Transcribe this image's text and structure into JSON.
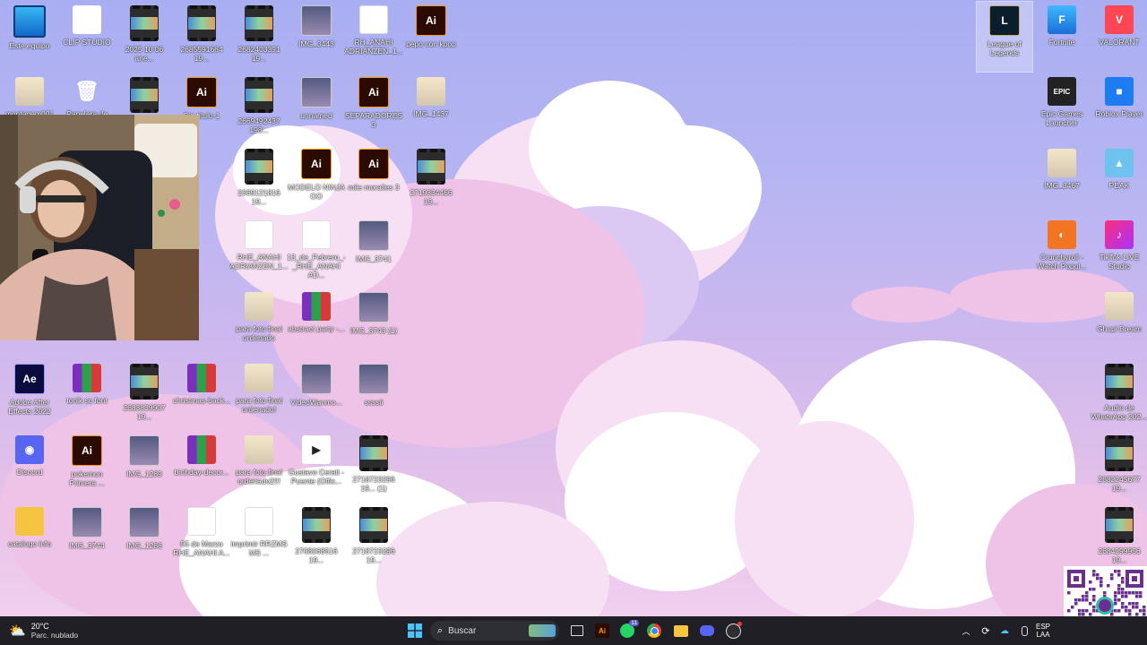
{
  "desktop_icons_left": [
    {
      "id": "pc",
      "label": "Este equipo",
      "icon": "computer-icon",
      "kind": "pc"
    },
    {
      "id": "clip",
      "label": "CLIP STUDIO",
      "icon": "clip-studio-icon",
      "kind": "clip"
    },
    {
      "id": "v1",
      "label": "2025 10 06 ane...",
      "icon": "video-icon",
      "kind": "video"
    },
    {
      "id": "v2",
      "label": "2685591664 19...",
      "icon": "video-icon",
      "kind": "video"
    },
    {
      "id": "v3",
      "label": "2682403391 19...",
      "icon": "video-icon",
      "kind": "video"
    },
    {
      "id": "img3443",
      "label": "IMG_3443",
      "icon": "image-icon",
      "kind": "img"
    },
    {
      "id": "pdf1",
      "label": "RH_ANAHI ADRIANZEN_1...",
      "icon": "pdf-icon",
      "kind": "pdf"
    },
    {
      "id": "ai1",
      "label": "pepo con kpop",
      "icon": "illustrator-icon",
      "kind": "ai"
    },
    {
      "id": "montagem",
      "label": "montagem001",
      "icon": "image-icon",
      "kind": "photo"
    },
    {
      "id": "bin",
      "label": "Papelera de",
      "icon": "recycle-bin-icon",
      "kind": "bin"
    },
    {
      "id": "v4",
      "label": "25 (1)",
      "icon": "video-icon",
      "kind": "video"
    },
    {
      "id": "ai2",
      "label": "Sin título-1",
      "icon": "illustrator-icon",
      "kind": "ai"
    },
    {
      "id": "v5",
      "label": "2669492437 198...",
      "icon": "video-icon",
      "kind": "video"
    },
    {
      "id": "unnamed",
      "label": "unnamed",
      "icon": "image-icon",
      "kind": "img"
    },
    {
      "id": "ai3",
      "label": "SEPARADORES 3",
      "icon": "illustrator-icon",
      "kind": "ai"
    },
    {
      "id": "img1437",
      "label": "IMG_1437",
      "icon": "image-icon",
      "kind": "photo"
    },
    {
      "id": "v6",
      "label": "2669121816 19...",
      "icon": "video-icon",
      "kind": "video"
    },
    {
      "id": "ai4",
      "label": "MODELO NINJA OO",
      "icon": "illustrator-icon",
      "kind": "ai"
    },
    {
      "id": "ai5",
      "label": "mile moralles 3",
      "icon": "illustrator-icon",
      "kind": "ai"
    },
    {
      "id": "v7",
      "label": "2719334466 19...",
      "icon": "video-icon",
      "kind": "video"
    },
    {
      "id": "pdf2",
      "label": "RHE_ANAHI ADRIANZEN_1...",
      "icon": "pdf-icon",
      "kind": "pdf"
    },
    {
      "id": "pdf3",
      "label": "13_de_Febrero_-_RHE_ANAHI AD...",
      "icon": "pdf-icon",
      "kind": "pdf"
    },
    {
      "id": "img3741",
      "label": "IMG_3741",
      "icon": "image-icon",
      "kind": "img"
    },
    {
      "id": "para1",
      "label": "para foto final ordenado",
      "icon": "image-icon",
      "kind": "photo"
    },
    {
      "id": "rar1",
      "label": "abstract party -...",
      "icon": "winrar-icon",
      "kind": "rar"
    },
    {
      "id": "img3743",
      "label": "IMG_3743 (1)",
      "icon": "image-icon",
      "kind": "img"
    },
    {
      "id": "ae",
      "label": "Adobe After Effects 2022",
      "icon": "after-effects-icon",
      "kind": "ae"
    },
    {
      "id": "rar2",
      "label": "tonik sc font",
      "icon": "winrar-icon",
      "kind": "rar"
    },
    {
      "id": "v8",
      "label": "2683839907 19...",
      "icon": "video-icon",
      "kind": "video"
    },
    {
      "id": "rar3",
      "label": "christmas-back...",
      "icon": "winrar-icon",
      "kind": "rar"
    },
    {
      "id": "para2",
      "label": "para foto final ordenado!",
      "icon": "image-icon",
      "kind": "photo"
    },
    {
      "id": "vid",
      "label": "VideoWanmo...",
      "icon": "image-icon",
      "kind": "img"
    },
    {
      "id": "ssss",
      "label": "ssssii",
      "icon": "image-icon",
      "kind": "img"
    },
    {
      "id": "discord",
      "label": "Discord",
      "icon": "discord-icon",
      "kind": "discord"
    },
    {
      "id": "ai6",
      "label": "pokemon Primera ...",
      "icon": "illustrator-icon",
      "kind": "ai"
    },
    {
      "id": "img1289",
      "label": "IMG_1289",
      "icon": "image-icon",
      "kind": "img"
    },
    {
      "id": "rar4",
      "label": "birthday-decor...",
      "icon": "winrar-icon",
      "kind": "rar"
    },
    {
      "id": "para3",
      "label": "para foto final ordenado2!!!",
      "icon": "image-icon",
      "kind": "photo"
    },
    {
      "id": "gustavo",
      "label": "Gustavo Cerati - Puente (Offic...",
      "icon": "media-file-icon",
      "kind": "media"
    },
    {
      "id": "v9",
      "label": "2718723296 19... (1)",
      "icon": "video-icon",
      "kind": "video"
    },
    {
      "id": "folder",
      "label": "catalogo info",
      "icon": "folder-icon",
      "kind": "folder"
    },
    {
      "id": "img3744",
      "label": "IMG_3744",
      "icon": "image-icon",
      "kind": "img"
    },
    {
      "id": "img1286",
      "label": "IMG_1286",
      "icon": "image-icon",
      "kind": "img"
    },
    {
      "id": "pdf4",
      "label": "05 de Marzo RHE_ANAHI A...",
      "icon": "pdf-icon",
      "kind": "pdf"
    },
    {
      "id": "pdf5",
      "label": "imprimir RRZMS MS ...",
      "icon": "pdf-icon",
      "kind": "pdf"
    },
    {
      "id": "v10",
      "label": "2708068516 19...",
      "icon": "video-icon",
      "kind": "video"
    },
    {
      "id": "v11",
      "label": "2718723296 19...",
      "icon": "video-icon",
      "kind": "video"
    }
  ],
  "desktop_icons_right": [
    {
      "id": "lol",
      "label": "League of Legends",
      "icon": "league-of-legends-icon",
      "kind": "lol",
      "selected": true
    },
    {
      "id": "fortnite",
      "label": "Fortnite",
      "icon": "fortnite-icon",
      "kind": "fortnite"
    },
    {
      "id": "valorant",
      "label": "VALORANT",
      "icon": "valorant-icon",
      "kind": "valorant"
    },
    {
      "id": "epic",
      "label": "Epic Games Launcher",
      "icon": "epic-games-icon",
      "kind": "epic"
    },
    {
      "id": "roblox",
      "label": "Roblox Player",
      "icon": "roblox-icon",
      "kind": "roblox"
    },
    {
      "id": "img3467",
      "label": "IMG_3467",
      "icon": "image-icon",
      "kind": "photo"
    },
    {
      "id": "peak",
      "label": "PEAK",
      "icon": "peak-icon",
      "kind": "peak"
    },
    {
      "id": "crunchy",
      "label": "Crunchyroll - Watch Popul...",
      "icon": "crunchyroll-icon",
      "kind": "crunchy"
    },
    {
      "id": "tiktok",
      "label": "TikTok LIVE Studio",
      "icon": "tiktok-live-icon",
      "kind": "tiktok"
    },
    {
      "id": "ghupi",
      "label": "Ghupi Bream",
      "icon": "image-icon",
      "kind": "photo"
    },
    {
      "id": "audio",
      "label": "Audio de WhatsApp 202...",
      "icon": "video-icon",
      "kind": "video"
    },
    {
      "id": "v12",
      "label": "2682245677 19...",
      "icon": "video-icon",
      "kind": "video"
    },
    {
      "id": "v13",
      "label": "2684299956 19...",
      "icon": "video-icon",
      "kind": "video"
    }
  ],
  "taskbar": {
    "weather_temp": "20°C",
    "weather_desc": "Parc. nublado",
    "search_placeholder": "Buscar",
    "whatsapp_badge": "11",
    "lang_line1": "ESP",
    "lang_line2": "LAA"
  },
  "colors": {
    "taskbar": "#1f1f25",
    "accent": "#0078d4"
  }
}
